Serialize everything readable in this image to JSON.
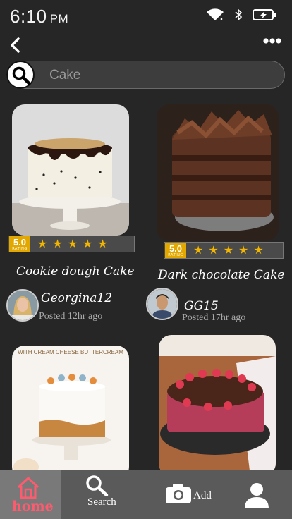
{
  "status": {
    "time": "6:10",
    "ampm": "PM"
  },
  "search": {
    "placeholder": "Cake"
  },
  "cards": [
    {
      "title": "Cookie dough Cake",
      "rating": "5.0",
      "rating_label": "RATING",
      "stars": 5,
      "user": "Georgina12",
      "posted": "Posted 12hr ago"
    },
    {
      "title": "Dark chocolate Cake",
      "rating": "5.0",
      "rating_label": "RATING",
      "stars": 5,
      "user": "GG15",
      "posted": "Posted 17hr ago"
    },
    {
      "caption": "WITH CREAM CHEESE BUTTERCREAM"
    },
    {
      "watermark": ""
    }
  ],
  "nav": {
    "home": "home",
    "search": "Search",
    "add": "Add"
  },
  "colors": {
    "background": "#262626",
    "star": "#f2b600",
    "badge": "#e2a800",
    "home_accent": "#ff5a6e",
    "nav": "#5a5a5a"
  },
  "icons": [
    "back-arrow-icon",
    "more-dots-icon",
    "wifi-icon",
    "bluetooth-icon",
    "battery-icon",
    "search-icon",
    "home-icon",
    "camera-icon",
    "profile-icon"
  ]
}
